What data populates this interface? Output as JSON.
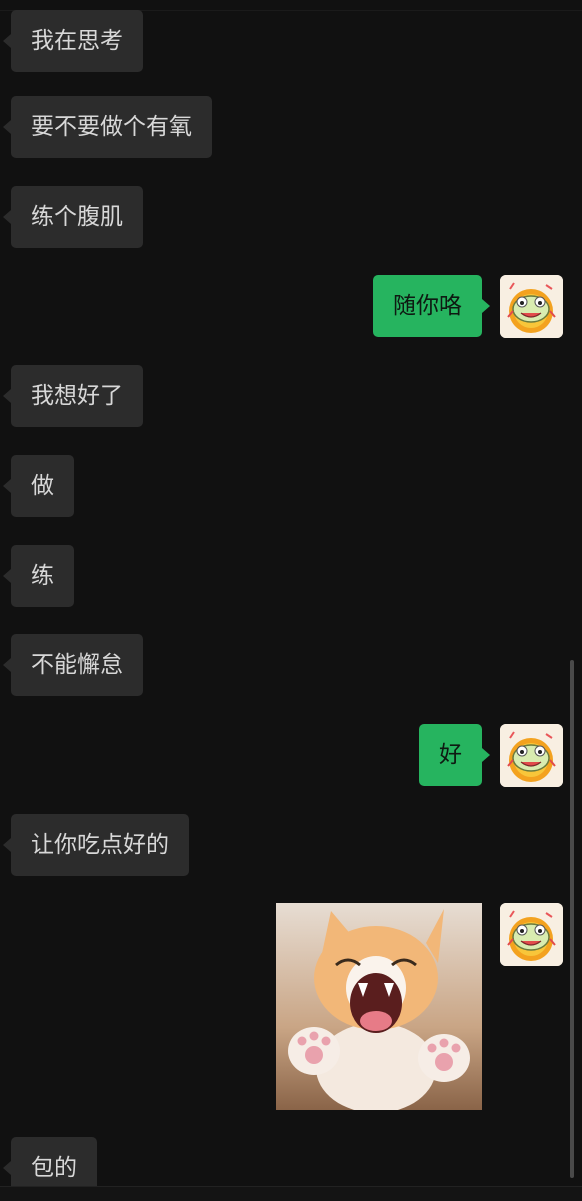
{
  "chat": {
    "messages": [
      {
        "dir": "in",
        "text": "我在思考"
      },
      {
        "dir": "in",
        "text": "要不要做个有氧"
      },
      {
        "dir": "in",
        "text": "练个腹肌"
      },
      {
        "dir": "out",
        "text": "随你咯"
      },
      {
        "dir": "in",
        "text": "我想好了"
      },
      {
        "dir": "in",
        "text": "做"
      },
      {
        "dir": "in",
        "text": "练"
      },
      {
        "dir": "in",
        "text": "不能懈怠"
      },
      {
        "dir": "out",
        "text": "好"
      },
      {
        "dir": "in",
        "text": "让你吃点好的"
      },
      {
        "dir": "out",
        "type": "sticker",
        "sticker": "laughing-cat"
      },
      {
        "dir": "in",
        "text": "包的"
      }
    ]
  },
  "colors": {
    "background": "#111111",
    "incoming_bubble": "#2c2c2c",
    "outgoing_bubble": "#26b45f"
  },
  "icons": {
    "avatar": "cartoon-frog-avatar",
    "sticker": "laughing-cat-sticker"
  }
}
